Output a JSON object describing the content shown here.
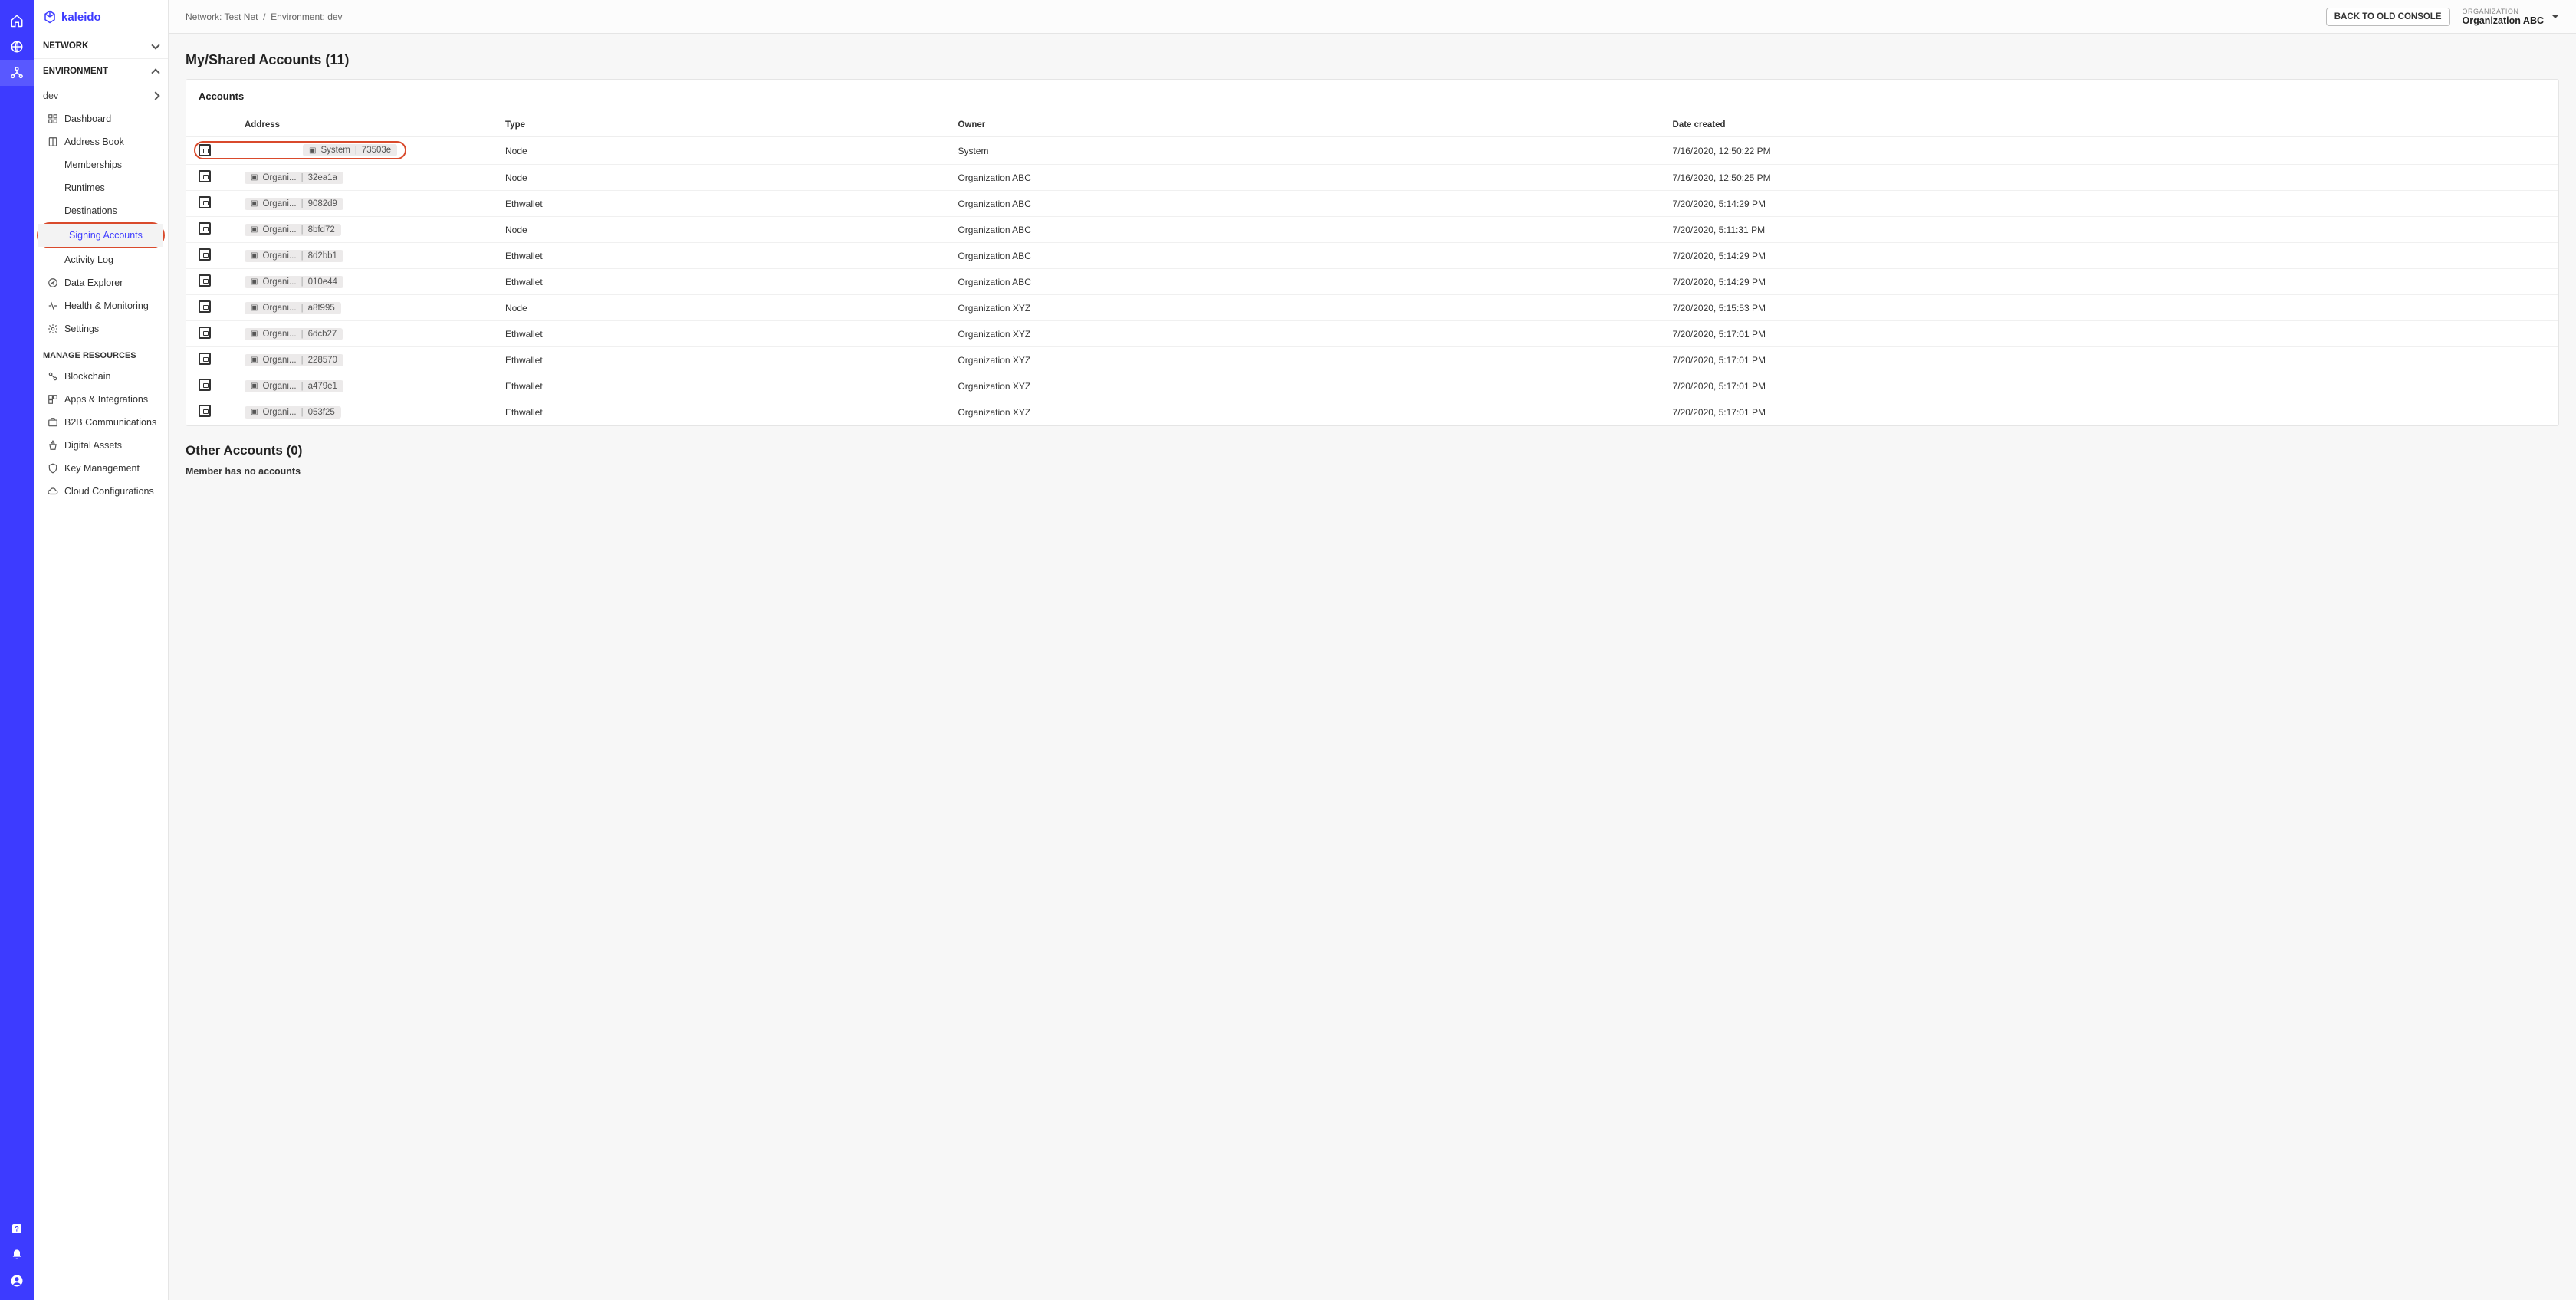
{
  "brand": "kaleido",
  "breadcrumb": {
    "network_label": "Network:",
    "network": "Test Net",
    "env_label": "Environment:",
    "env": "dev"
  },
  "topbar": {
    "back_button": "BACK TO OLD CONSOLE",
    "org_label": "ORGANIZATION",
    "org_name": "Organization ABC"
  },
  "sidebar": {
    "network_hdr": "NETWORK",
    "environment_hdr": "ENVIRONMENT",
    "env_name": "dev",
    "items": {
      "dashboard": "Dashboard",
      "address_book": "Address Book",
      "memberships": "Memberships",
      "runtimes": "Runtimes",
      "destinations": "Destinations",
      "signing_accounts": "Signing Accounts",
      "activity_log": "Activity Log",
      "data_explorer": "Data Explorer",
      "health": "Health & Monitoring",
      "settings": "Settings"
    },
    "manage_hdr": "MANAGE RESOURCES",
    "manage": {
      "blockchain": "Blockchain",
      "apps": "Apps & Integrations",
      "b2b": "B2B Communications",
      "digital_assets": "Digital Assets",
      "key_mgmt": "Key Management",
      "cloud": "Cloud Configurations"
    }
  },
  "page": {
    "title": "My/Shared Accounts (11)",
    "card_title": "Accounts",
    "columns": {
      "address": "Address",
      "type": "Type",
      "owner": "Owner",
      "date": "Date created"
    },
    "rows": [
      {
        "org": "System",
        "hash": "73503e",
        "type": "Node",
        "owner": "System",
        "date": "7/16/2020, 12:50:22 PM",
        "hl": true
      },
      {
        "org": "Organi...",
        "hash": "32ea1a",
        "type": "Node",
        "owner": "Organization ABC",
        "date": "7/16/2020, 12:50:25 PM"
      },
      {
        "org": "Organi...",
        "hash": "9082d9",
        "type": "Ethwallet",
        "owner": "Organization ABC",
        "date": "7/20/2020, 5:14:29 PM"
      },
      {
        "org": "Organi...",
        "hash": "8bfd72",
        "type": "Node",
        "owner": "Organization ABC",
        "date": "7/20/2020, 5:11:31 PM"
      },
      {
        "org": "Organi...",
        "hash": "8d2bb1",
        "type": "Ethwallet",
        "owner": "Organization ABC",
        "date": "7/20/2020, 5:14:29 PM"
      },
      {
        "org": "Organi...",
        "hash": "010e44",
        "type": "Ethwallet",
        "owner": "Organization ABC",
        "date": "7/20/2020, 5:14:29 PM"
      },
      {
        "org": "Organi...",
        "hash": "a8f995",
        "type": "Node",
        "owner": "Organization XYZ",
        "date": "7/20/2020, 5:15:53 PM"
      },
      {
        "org": "Organi...",
        "hash": "6dcb27",
        "type": "Ethwallet",
        "owner": "Organization XYZ",
        "date": "7/20/2020, 5:17:01 PM"
      },
      {
        "org": "Organi...",
        "hash": "228570",
        "type": "Ethwallet",
        "owner": "Organization XYZ",
        "date": "7/20/2020, 5:17:01 PM"
      },
      {
        "org": "Organi...",
        "hash": "a479e1",
        "type": "Ethwallet",
        "owner": "Organization XYZ",
        "date": "7/20/2020, 5:17:01 PM"
      },
      {
        "org": "Organi...",
        "hash": "053f25",
        "type": "Ethwallet",
        "owner": "Organization XYZ",
        "date": "7/20/2020, 5:17:01 PM"
      }
    ],
    "other_title": "Other Accounts (0)",
    "other_empty": "Member has no accounts"
  }
}
